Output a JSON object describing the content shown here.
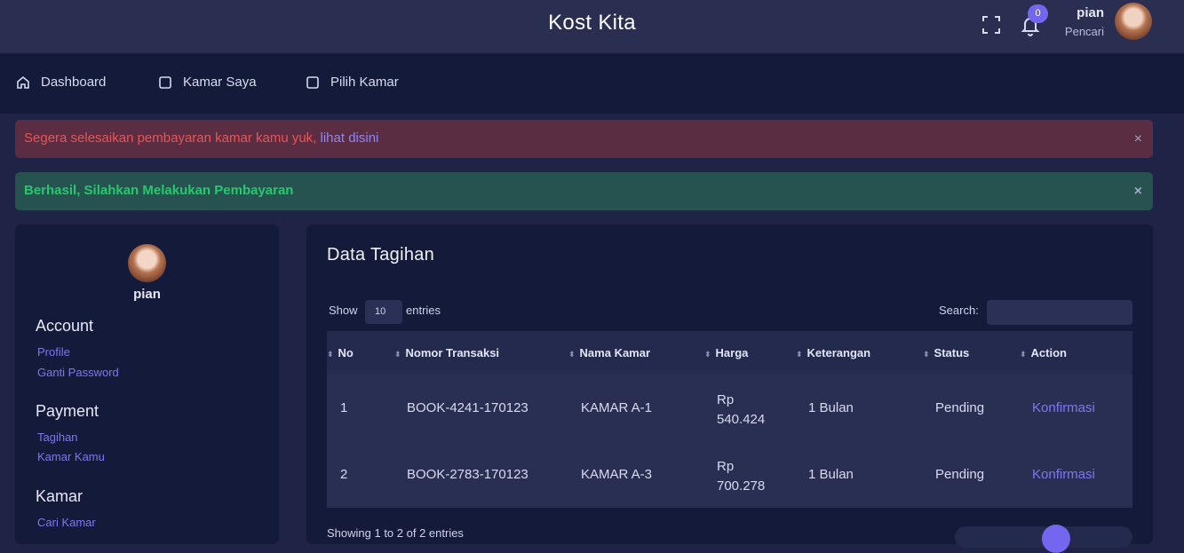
{
  "header": {
    "brand": "Kost Kita",
    "notification_count": "0",
    "user_name": "pian",
    "user_role": "Pencari"
  },
  "nav": {
    "items": [
      {
        "label": "Dashboard",
        "icon": "home-icon"
      },
      {
        "label": "Kamar Saya",
        "icon": "square-icon"
      },
      {
        "label": "Pilih Kamar",
        "icon": "square-icon"
      }
    ]
  },
  "alerts": {
    "danger_text": "Segera selesaikan pembayaran kamar kamu yuk,",
    "danger_link": "lihat disini",
    "success_text": "Berhasil, Silahkan Melakukan Pembayaran",
    "close": "×"
  },
  "sidebar": {
    "name": "pian",
    "sections": [
      {
        "title": "Account",
        "links": [
          "Profile",
          "Ganti Password"
        ]
      },
      {
        "title": "Payment",
        "links": [
          "Tagihan",
          "Kamar Kamu"
        ]
      },
      {
        "title": "Kamar",
        "links": [
          "Cari Kamar"
        ]
      }
    ]
  },
  "table": {
    "title": "Data Tagihan",
    "show_label": "Show",
    "entries_value": "10",
    "entries_label": "entries",
    "search_label": "Search:",
    "columns": [
      "No",
      "Nomor Transaksi",
      "Nama Kamar",
      "Harga",
      "Keterangan",
      "Status",
      "Action"
    ],
    "rows": [
      {
        "no": "1",
        "nomor": "BOOK-4241-170123",
        "kamar": "KAMAR A-1",
        "harga_a": "Rp",
        "harga_b": "540.424",
        "ket": "1 Bulan",
        "status": "Pending",
        "action": "Konfirmasi"
      },
      {
        "no": "2",
        "nomor": "BOOK-2783-170123",
        "kamar": "KAMAR A-3",
        "harga_a": "Rp",
        "harga_b": "700.278",
        "ket": "1 Bulan",
        "status": "Pending",
        "action": "Konfirmasi"
      }
    ],
    "footer_info": "Showing 1 to 2 of 2 entries"
  },
  "colors": {
    "accent": "#7367f0",
    "danger": "#ea5455",
    "success": "#28c76f"
  }
}
